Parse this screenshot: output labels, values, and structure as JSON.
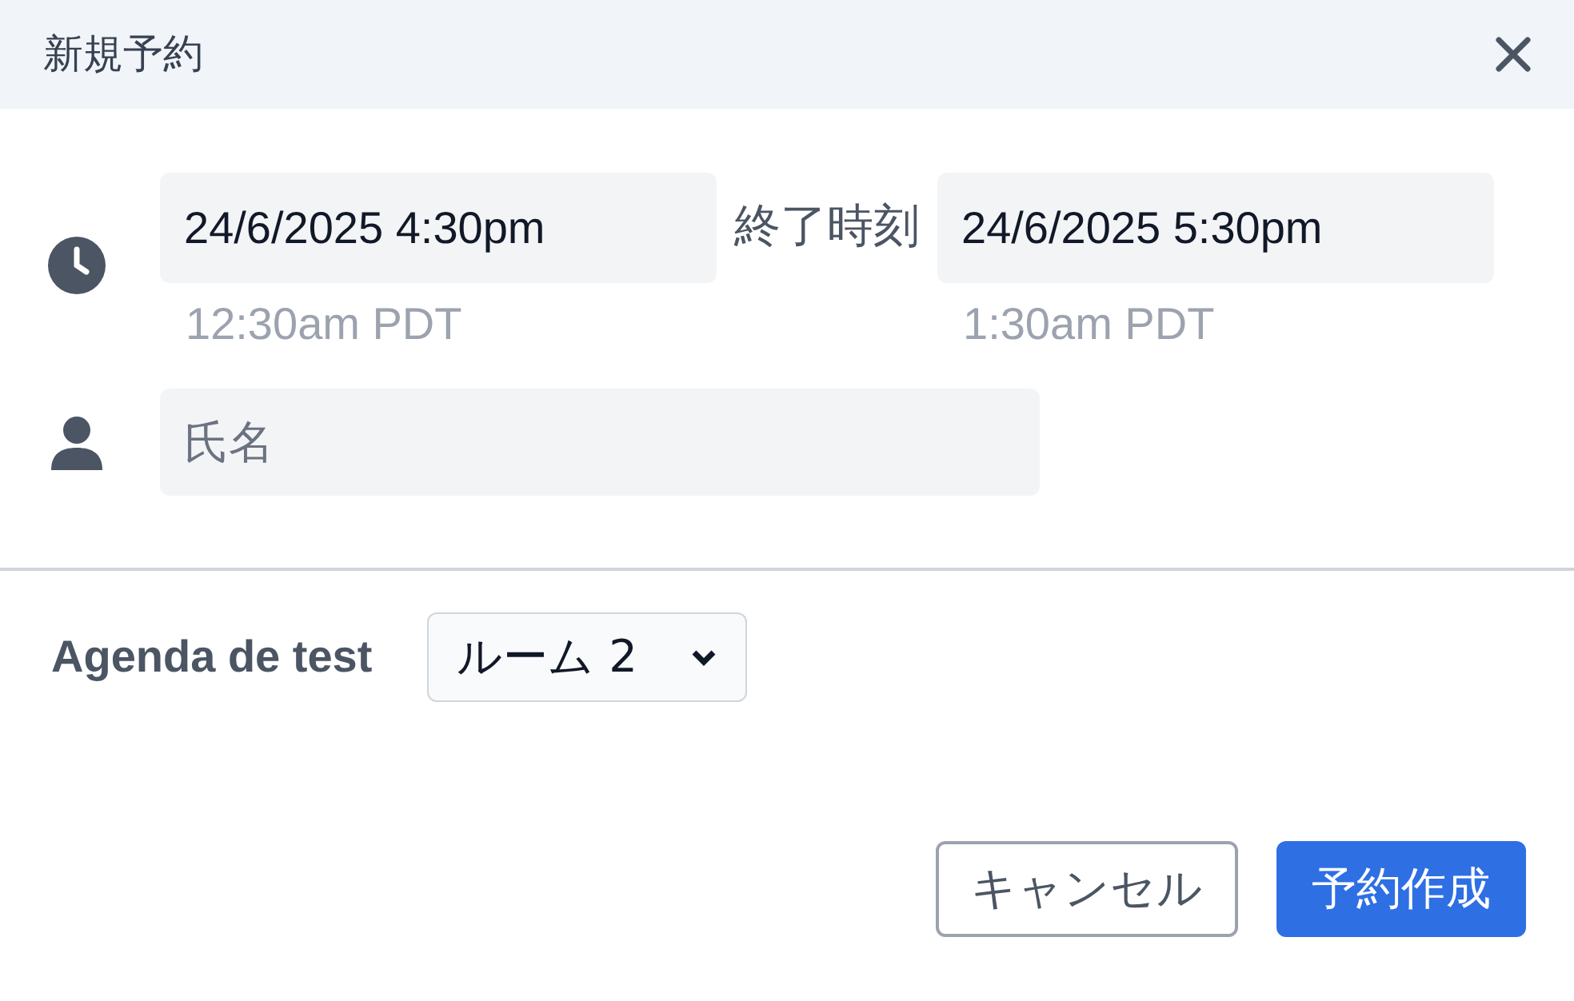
{
  "dialog": {
    "title": "新規予約"
  },
  "start": {
    "value": "24/6/2025 4:30pm",
    "local_time": "12:30am PDT"
  },
  "end_label": "終了時刻",
  "end": {
    "value": "24/6/2025 5:30pm",
    "local_time": "1:30am PDT"
  },
  "name_field": {
    "placeholder": "氏名"
  },
  "calendar": {
    "label": "Agenda de test",
    "value": "ルーム 2"
  },
  "buttons": [
    {
      "label": "キャンセル",
      "kind": "secondary"
    },
    {
      "label": "予約作成",
      "kind": "primary"
    }
  ]
}
